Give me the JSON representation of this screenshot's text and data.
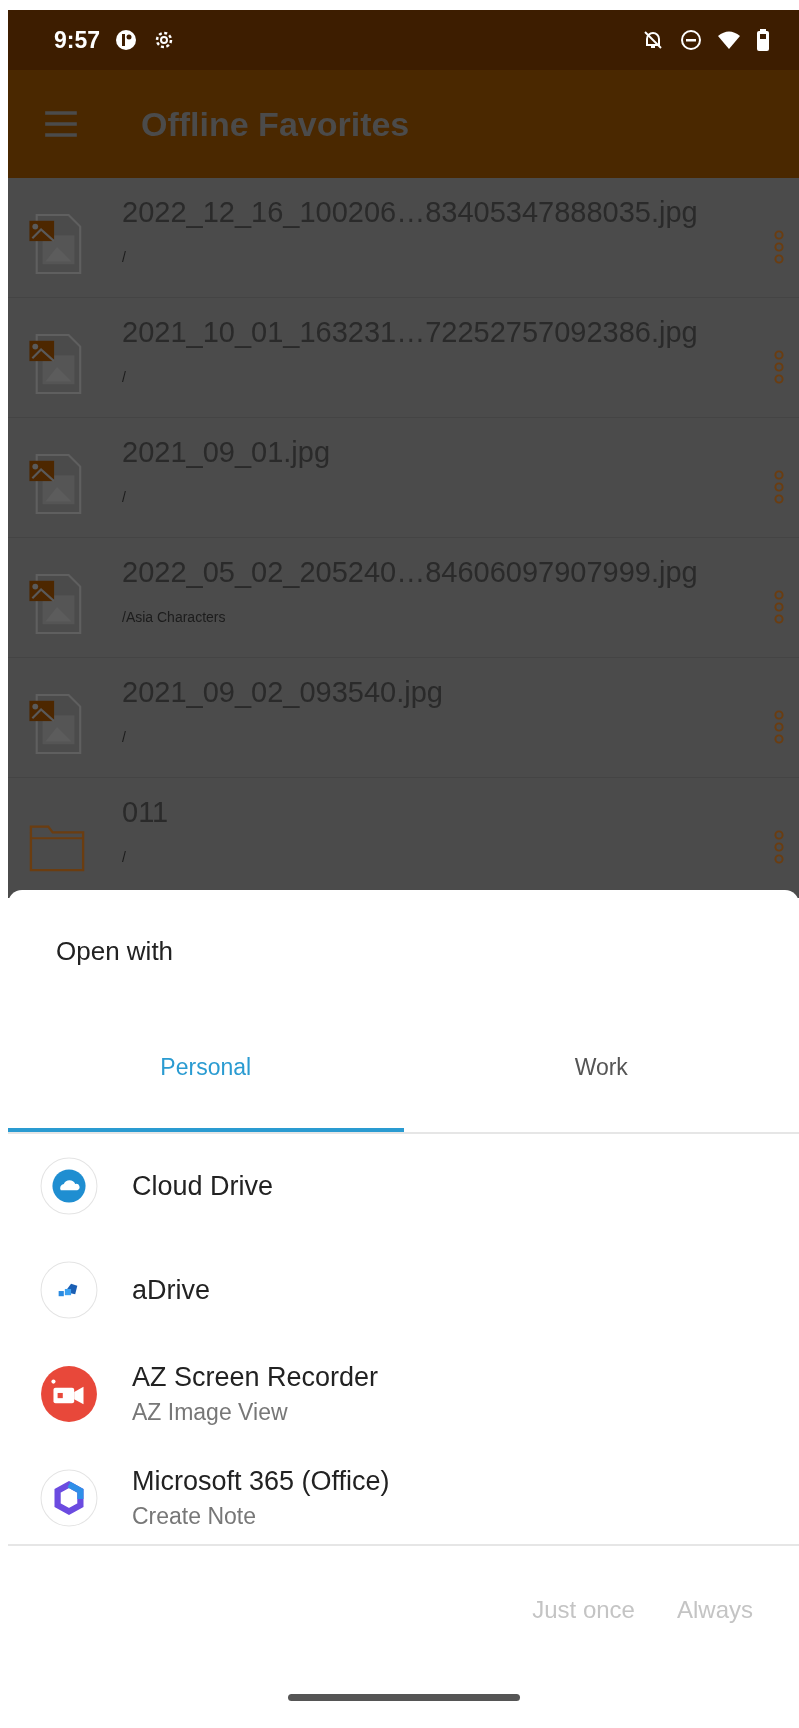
{
  "status_bar": {
    "time": "9:57"
  },
  "app_bar": {
    "title": "Offline Favorites"
  },
  "files": [
    {
      "name": "2022_12_16_100206…83405347888035.jpg",
      "path": "/",
      "kind": "image"
    },
    {
      "name": "2021_10_01_163231…72252757092386.jpg",
      "path": "/",
      "kind": "image"
    },
    {
      "name": "2021_09_01.jpg",
      "path": "/",
      "kind": "image"
    },
    {
      "name": "2022_05_02_205240…84606097907999.jpg",
      "path": "/Asia Characters",
      "kind": "image"
    },
    {
      "name": "2021_09_02_093540.jpg",
      "path": "/",
      "kind": "image"
    },
    {
      "name": "011",
      "path": "/",
      "kind": "folder"
    }
  ],
  "sheet": {
    "title": "Open with",
    "tabs": [
      {
        "label": "Personal",
        "selected": true
      },
      {
        "label": "Work",
        "selected": false
      }
    ],
    "apps": [
      {
        "name": "Cloud Drive",
        "kind": "cloud"
      },
      {
        "name": "aDrive",
        "kind": "adrive"
      },
      {
        "name": "AZ Screen Recorder",
        "subtitle": "AZ Image View",
        "kind": "recorder"
      },
      {
        "name": "Microsoft 365 (Office)",
        "subtitle": "Create Note",
        "kind": "office"
      }
    ],
    "buttons": [
      {
        "label": "Just once",
        "disabled": true
      },
      {
        "label": "Always",
        "disabled": true
      }
    ]
  }
}
